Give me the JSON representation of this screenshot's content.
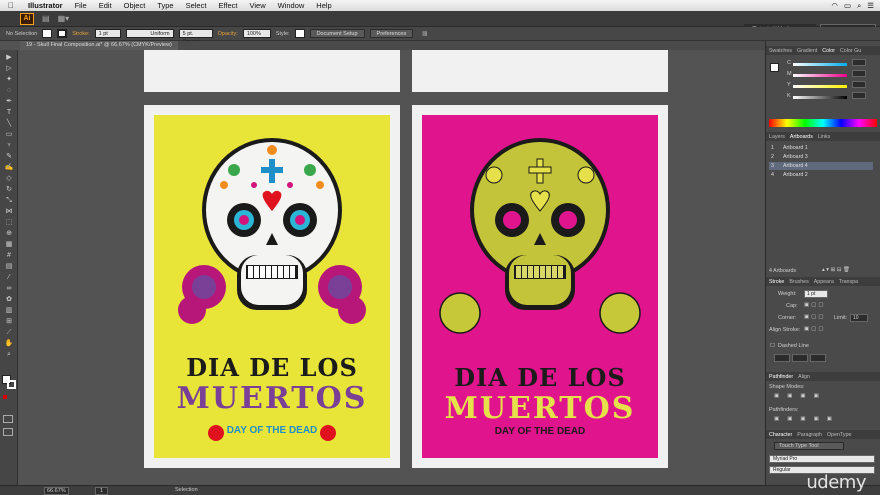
{
  "menubar": {
    "app": "Illustrator",
    "items": [
      "File",
      "Edit",
      "Object",
      "Type",
      "Select",
      "Effect",
      "View",
      "Window",
      "Help"
    ]
  },
  "appbar": {
    "logo": "Ai",
    "workspace": "Tutorial Workspace"
  },
  "control": {
    "selection": "No Selection",
    "stroke_label": "Stroke:",
    "stroke_value": "1 pt",
    "profile": "Uniform",
    "brush": "5 pt. Round",
    "opacity_label": "Opacity:",
    "opacity_value": "100%",
    "style_label": "Style:",
    "document_setup": "Document Setup",
    "preferences": "Preferences"
  },
  "document_tab": "19 - Skull Final Composition.ai* @ 66.67% (CMYK/Preview)",
  "artboards": {
    "left": {
      "background": "#e8e438",
      "line1": "DIA DE LOS",
      "line2": "MUERTOS",
      "line3": "DAY OF THE DEAD",
      "line1_color": "#1b1b1b",
      "line2_color": "#7a3f97",
      "line3_color": "#1e8fc9"
    },
    "right": {
      "background": "#e0148c",
      "line1": "DIA DE LOS",
      "line2": "MUERTOS",
      "line3": "DAY OF THE DEAD",
      "line1_color": "#1b1b1b",
      "line2_color": "#e6e14a",
      "line3_color": "#1b1b1b"
    }
  },
  "panels": {
    "color_tabs": [
      "Swatches",
      "Gradient",
      "Color",
      "Color Gu"
    ],
    "color_channels": [
      "C",
      "M",
      "Y",
      "K"
    ],
    "layer_tabs": [
      "Layers",
      "Artboards",
      "Links"
    ],
    "artboards_list": [
      {
        "num": "1",
        "name": "Artboard 1"
      },
      {
        "num": "2",
        "name": "Artboard 3"
      },
      {
        "num": "3",
        "name": "Artboard 4"
      },
      {
        "num": "4",
        "name": "Artboard 2"
      }
    ],
    "artboards_count": "4 Artboards",
    "stroke_tabs": [
      "Stroke",
      "Brushes",
      "Appeara",
      "Transpa"
    ],
    "weight_label": "Weight:",
    "weight_value": "1 pt",
    "cap_label": "Cap:",
    "corner_label": "Corner:",
    "limit_label": "Limit:",
    "limit_value": "10",
    "align_stroke_label": "Align Stroke:",
    "dashed_line_label": "Dashed Line",
    "pathfinder_tabs": [
      "Pathfinder",
      "Align"
    ],
    "shape_modes_label": "Shape Modes:",
    "pathfinders_label": "Pathfinders:",
    "character_tabs": [
      "Character",
      "Paragraph",
      "OpenType"
    ],
    "touch_type_tool": "Touch Type Tool",
    "font_family": "Myriad Pro",
    "font_style": "Regular"
  },
  "status": {
    "zoom": "66.67%",
    "page": "1",
    "tool": "Selection"
  },
  "watermark": "udemy",
  "colors": {
    "accent_orange": "#f7a01c",
    "selected_row": "#5f6a7d"
  }
}
